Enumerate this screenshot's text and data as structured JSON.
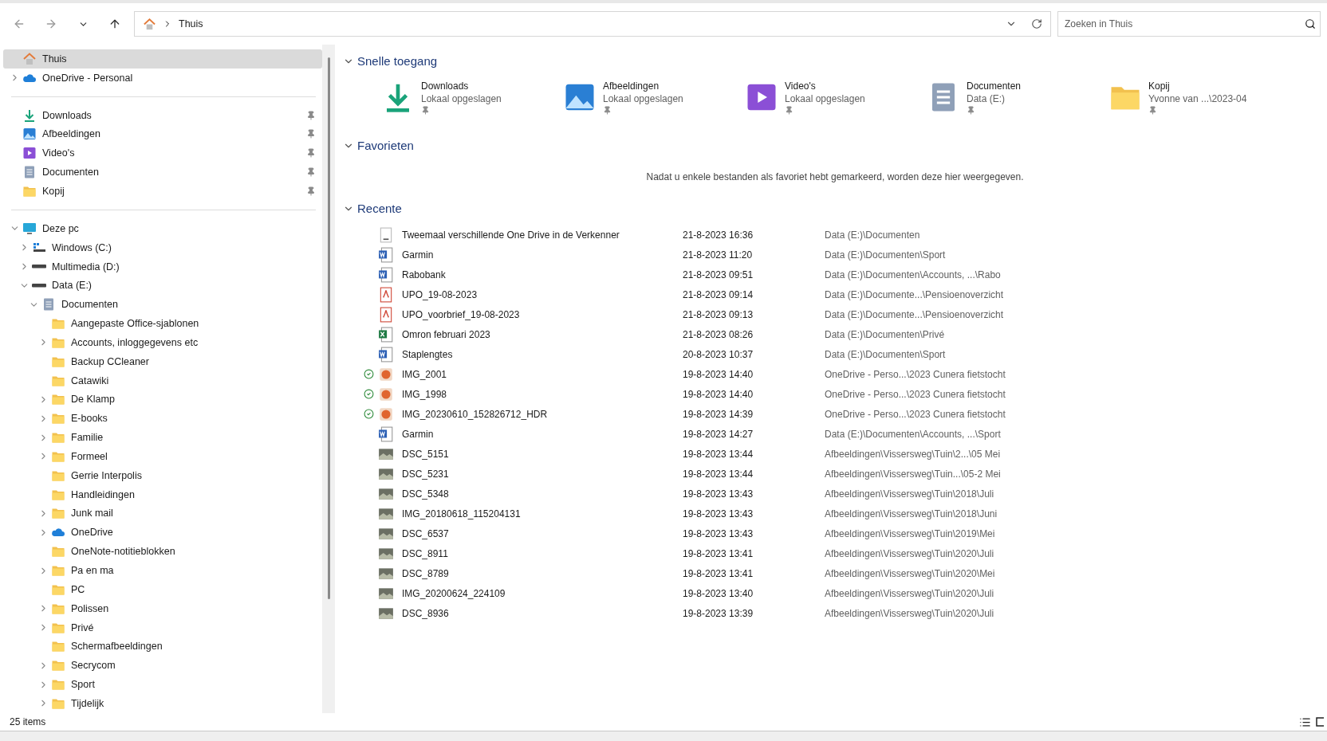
{
  "nav": [
    {
      "kind": "back",
      "disabled": true
    },
    {
      "kind": "forward",
      "disabled": true
    },
    {
      "kind": "recent",
      "disabled": false
    },
    {
      "kind": "up",
      "disabled": false
    }
  ],
  "address": {
    "path": "Thuis"
  },
  "search": {
    "placeholder": "Zoeken in Thuis"
  },
  "sidebar": {
    "groups": [
      [
        {
          "label": "Thuis",
          "kind": "home",
          "selected": true
        },
        {
          "label": "OneDrive - Personal",
          "kind": "cloud",
          "selected": false,
          "expanded": false
        }
      ],
      [
        {
          "label": "Downloads",
          "kind": "download",
          "selected": false,
          "pinned": true
        },
        {
          "label": "Afbeeldingen",
          "kind": "pictures",
          "selected": false,
          "pinned": true
        },
        {
          "label": "Video's",
          "kind": "video",
          "selected": false,
          "pinned": true
        },
        {
          "label": "Documenten",
          "kind": "documents",
          "selected": false,
          "pinned": true
        },
        {
          "label": "Kopij",
          "kind": "folder",
          "selected": false,
          "pinned": true
        }
      ],
      [
        {
          "label": "Deze pc",
          "kind": "pc",
          "selected": false,
          "expanded": true,
          "children": [
            {
              "label": "Windows (C:)",
              "kind": "windrive",
              "selected": false,
              "expanded": false
            },
            {
              "label": "Multimedia (D:)",
              "kind": "drive",
              "selected": false,
              "expanded": false
            },
            {
              "label": "Data (E:)",
              "kind": "drive",
              "selected": false,
              "expanded": true,
              "children": [
                {
                  "label": "Documenten",
                  "kind": "documents",
                  "selected": false,
                  "expanded": true,
                  "children": [
                    {
                      "label": "Aangepaste Office-sjablonen",
                      "kind": "folder",
                      "selected": false
                    },
                    {
                      "label": "Accounts, inloggegevens etc",
                      "kind": "folder",
                      "selected": false,
                      "expanded": false
                    },
                    {
                      "label": "Backup CCleaner",
                      "kind": "folder",
                      "selected": false
                    },
                    {
                      "label": "Catawiki",
                      "kind": "folder",
                      "selected": false
                    },
                    {
                      "label": "De Klamp",
                      "kind": "folder",
                      "selected": false,
                      "expanded": false
                    },
                    {
                      "label": "E-books",
                      "kind": "folder",
                      "selected": false,
                      "expanded": false
                    },
                    {
                      "label": "Familie",
                      "kind": "folder",
                      "selected": false,
                      "expanded": false
                    },
                    {
                      "label": "Formeel",
                      "kind": "folder",
                      "selected": false,
                      "expanded": false
                    },
                    {
                      "label": "Gerrie Interpolis",
                      "kind": "folder",
                      "selected": false
                    },
                    {
                      "label": "Handleidingen",
                      "kind": "folder",
                      "selected": false
                    },
                    {
                      "label": "Junk mail",
                      "kind": "folder",
                      "selected": false,
                      "expanded": false
                    },
                    {
                      "label": "OneDrive",
                      "kind": "cloud",
                      "selected": false,
                      "expanded": false
                    },
                    {
                      "label": "OneNote-notitieblokken",
                      "kind": "folder",
                      "selected": false
                    },
                    {
                      "label": "Pa en ma",
                      "kind": "folder",
                      "selected": false,
                      "expanded": false
                    },
                    {
                      "label": "PC",
                      "kind": "folder",
                      "selected": false
                    },
                    {
                      "label": "Polissen",
                      "kind": "folder",
                      "selected": false,
                      "expanded": false
                    },
                    {
                      "label": "Privé",
                      "kind": "folder",
                      "selected": false,
                      "expanded": false
                    },
                    {
                      "label": "Schermafbeeldingen",
                      "kind": "folder",
                      "selected": false
                    },
                    {
                      "label": "Secrycom",
                      "kind": "folder",
                      "selected": false,
                      "expanded": false
                    },
                    {
                      "label": "Sport",
                      "kind": "folder",
                      "selected": false,
                      "expanded": false
                    },
                    {
                      "label": "Tijdelijk",
                      "kind": "folder",
                      "selected": false,
                      "expanded": false
                    }
                  ]
                }
              ]
            }
          ]
        }
      ]
    ]
  },
  "quick_access": {
    "title": "Snelle toegang",
    "expanded": true,
    "items": [
      {
        "name": "Downloads",
        "location": "Lokaal opgeslagen",
        "kind": "download",
        "pinned": true
      },
      {
        "name": "Afbeeldingen",
        "location": "Lokaal opgeslagen",
        "kind": "pictures",
        "pinned": true
      },
      {
        "name": "Video's",
        "location": "Lokaal opgeslagen",
        "kind": "video",
        "pinned": true
      },
      {
        "name": "Documenten",
        "location": "Data (E:)",
        "kind": "documents",
        "pinned": true
      },
      {
        "name": "Kopij",
        "location": "Yvonne van ...\\2023-04",
        "kind": "folder",
        "pinned": true
      }
    ]
  },
  "favorites": {
    "title": "Favorieten",
    "expanded": true,
    "empty_message": "Nadat u enkele bestanden als favoriet hebt gemarkeerd, worden deze hier weergegeven."
  },
  "recent": {
    "title": "Recente",
    "expanded": true,
    "rows": [
      {
        "name": "Tweemaal verschillende One Drive in de Verkenner",
        "date": "21-8-2023 16:36",
        "location": "Data (E:)\\Documenten",
        "kind": "blank",
        "synced": false
      },
      {
        "name": "Garmin",
        "date": "21-8-2023 11:20",
        "location": "Data (E:)\\Documenten\\Sport",
        "kind": "word",
        "synced": false
      },
      {
        "name": "Rabobank",
        "date": "21-8-2023 09:51",
        "location": "Data (E:)\\Documenten\\Accounts, ...\\Rabo",
        "kind": "word",
        "synced": false
      },
      {
        "name": "UPO_19-08-2023",
        "date": "21-8-2023 09:14",
        "location": "Data (E:)\\Documente...\\Pensioenoverzicht",
        "kind": "pdf",
        "synced": false
      },
      {
        "name": "UPO_voorbrief_19-08-2023",
        "date": "21-8-2023 09:13",
        "location": "Data (E:)\\Documente...\\Pensioenoverzicht",
        "kind": "pdf",
        "synced": false
      },
      {
        "name": "Omron februari 2023",
        "date": "21-8-2023 08:26",
        "location": "Data (E:)\\Documenten\\Privé",
        "kind": "excel",
        "synced": false
      },
      {
        "name": "Staplengtes",
        "date": "20-8-2023 10:37",
        "location": "Data (E:)\\Documenten\\Sport",
        "kind": "word",
        "synced": false
      },
      {
        "name": "IMG_2001",
        "date": "19-8-2023 14:40",
        "location": "OneDrive - Perso...\\2023 Cunera fietstocht",
        "kind": "image",
        "synced": true
      },
      {
        "name": "IMG_1998",
        "date": "19-8-2023 14:40",
        "location": "OneDrive - Perso...\\2023 Cunera fietstocht",
        "kind": "image",
        "synced": true
      },
      {
        "name": "IMG_20230610_152826712_HDR",
        "date": "19-8-2023 14:39",
        "location": "OneDrive - Perso...\\2023 Cunera fietstocht",
        "kind": "image",
        "synced": true
      },
      {
        "name": "Garmin",
        "date": "19-8-2023 14:27",
        "location": "Data (E:)\\Documenten\\Accounts, ...\\Sport",
        "kind": "word",
        "synced": false
      },
      {
        "name": "DSC_5151",
        "date": "19-8-2023 13:44",
        "location": "Afbeeldingen\\Vissersweg\\Tuin\\2...\\05 Mei",
        "kind": "photo",
        "synced": false
      },
      {
        "name": "DSC_5231",
        "date": "19-8-2023 13:44",
        "location": "Afbeeldingen\\Vissersweg\\Tuin...\\05-2 Mei",
        "kind": "photo",
        "synced": false
      },
      {
        "name": "DSC_5348",
        "date": "19-8-2023 13:43",
        "location": "Afbeeldingen\\Vissersweg\\Tuin\\2018\\Juli",
        "kind": "photo",
        "synced": false
      },
      {
        "name": "IMG_20180618_115204131",
        "date": "19-8-2023 13:43",
        "location": "Afbeeldingen\\Vissersweg\\Tuin\\2018\\Juni",
        "kind": "photo",
        "synced": false
      },
      {
        "name": "DSC_6537",
        "date": "19-8-2023 13:43",
        "location": "Afbeeldingen\\Vissersweg\\Tuin\\2019\\Mei",
        "kind": "photo",
        "synced": false
      },
      {
        "name": "DSC_8911",
        "date": "19-8-2023 13:41",
        "location": "Afbeeldingen\\Vissersweg\\Tuin\\2020\\Juli",
        "kind": "photo",
        "synced": false
      },
      {
        "name": "DSC_8789",
        "date": "19-8-2023 13:41",
        "location": "Afbeeldingen\\Vissersweg\\Tuin\\2020\\Mei",
        "kind": "photo",
        "synced": false
      },
      {
        "name": "IMG_20200624_224109",
        "date": "19-8-2023 13:40",
        "location": "Afbeeldingen\\Vissersweg\\Tuin\\2020\\Juli",
        "kind": "photo",
        "synced": false
      },
      {
        "name": "DSC_8936",
        "date": "19-8-2023 13:39",
        "location": "Afbeeldingen\\Vissersweg\\Tuin\\2020\\Juli",
        "kind": "photo",
        "synced": false
      }
    ]
  },
  "status_bar": {
    "count": "25 items"
  }
}
